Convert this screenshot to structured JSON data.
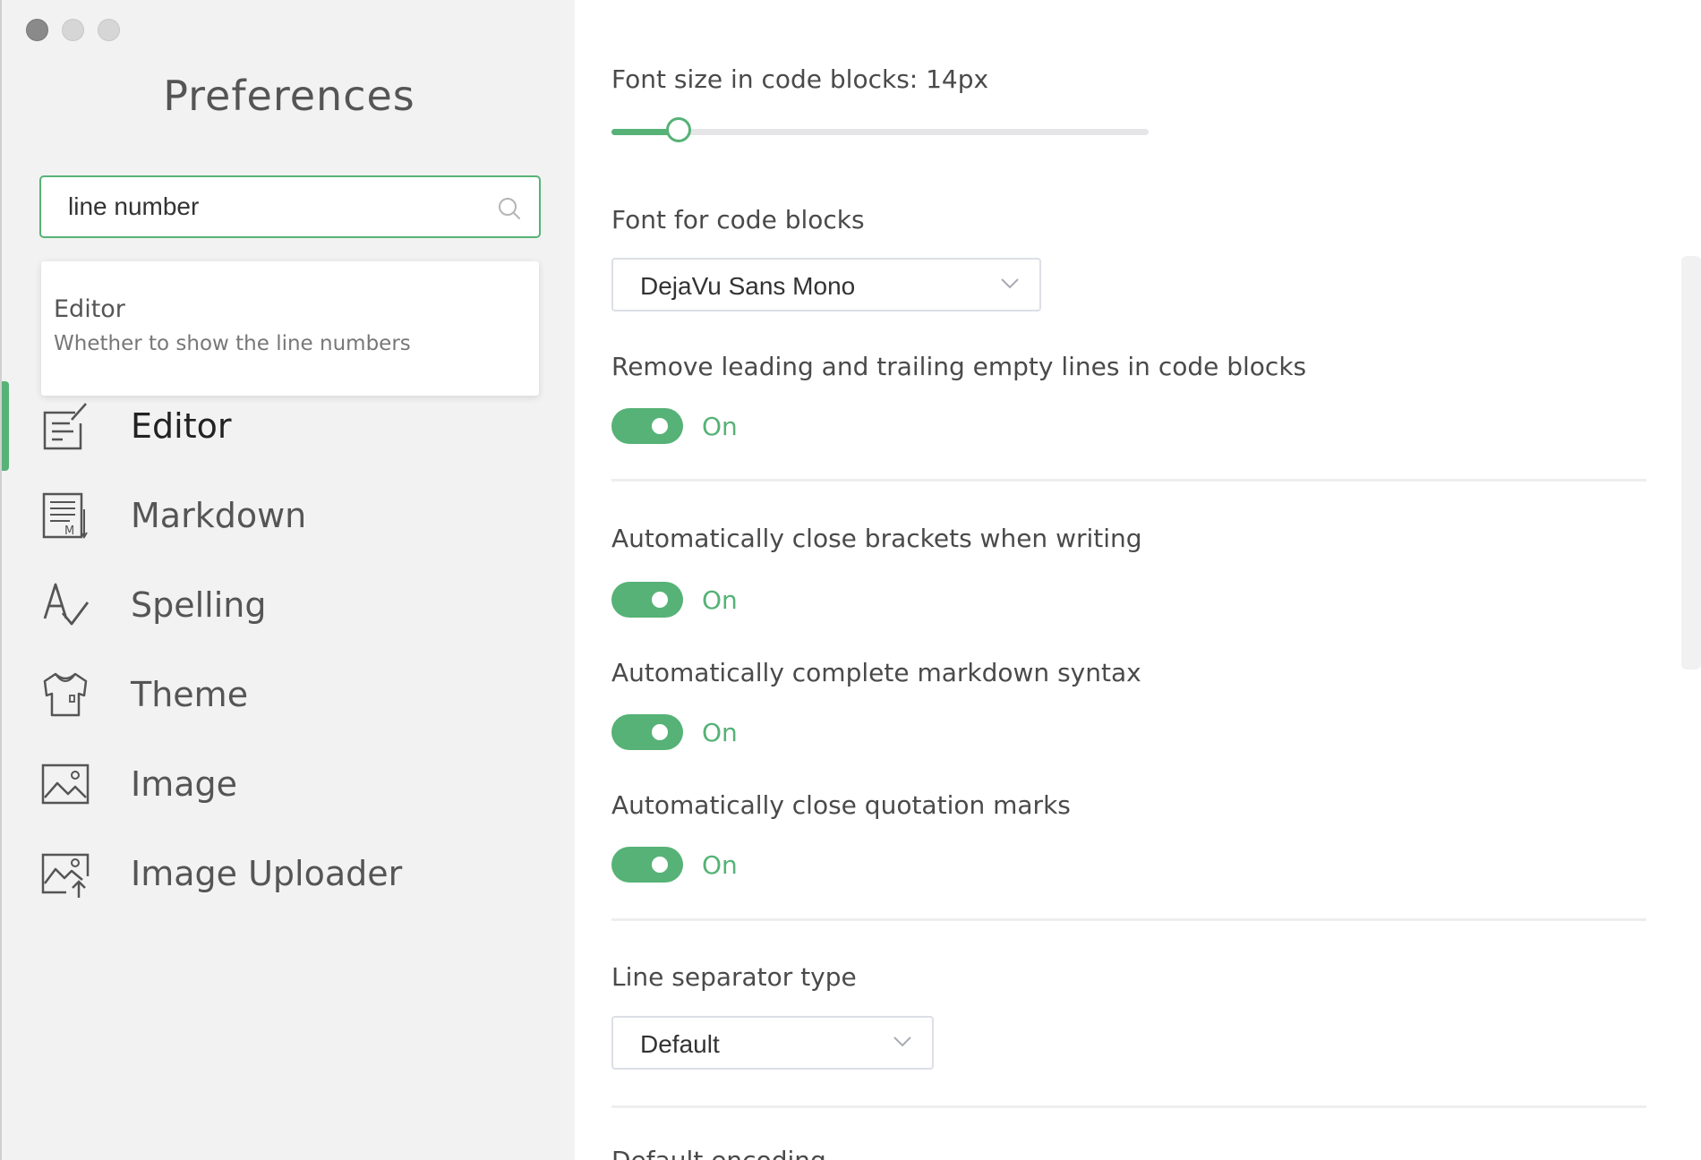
{
  "window": {
    "controls": [
      "close",
      "minimize",
      "maximize"
    ]
  },
  "sidebar": {
    "title": "Preferences",
    "search": {
      "value": "line number",
      "icon": "search-icon"
    },
    "search_results": [
      {
        "category": "Editor",
        "description": "Whether to show the line numbers"
      }
    ],
    "active_item": "Editor",
    "items": [
      {
        "label": "Editor",
        "icon": "editor-icon"
      },
      {
        "label": "Markdown",
        "icon": "markdown-icon"
      },
      {
        "label": "Spelling",
        "icon": "spelling-icon"
      },
      {
        "label": "Theme",
        "icon": "theme-icon"
      },
      {
        "label": "Image",
        "icon": "image-icon"
      },
      {
        "label": "Image Uploader",
        "icon": "image-uploader-icon"
      }
    ]
  },
  "main": {
    "font_size": {
      "label": "Font size in code blocks: 14px",
      "slider_fraction": 0.125
    },
    "font_family": {
      "label": "Font for code blocks",
      "value": "DejaVu Sans Mono"
    },
    "trim_lines": {
      "label": "Remove leading and trailing empty lines in code blocks",
      "state": "On"
    },
    "auto_brackets": {
      "label": "Automatically close brackets when writing",
      "state": "On"
    },
    "auto_markdown": {
      "label": "Automatically complete markdown syntax",
      "state": "On"
    },
    "auto_quotes": {
      "label": "Automatically close quotation marks",
      "state": "On"
    },
    "line_separator": {
      "label": "Line separator type",
      "value": "Default"
    },
    "default_encoding": {
      "label": "Default encoding"
    }
  },
  "colors": {
    "accent": "#56b276",
    "sidebar_bg": "#f2f2f2",
    "text": "#4a4a4a"
  }
}
